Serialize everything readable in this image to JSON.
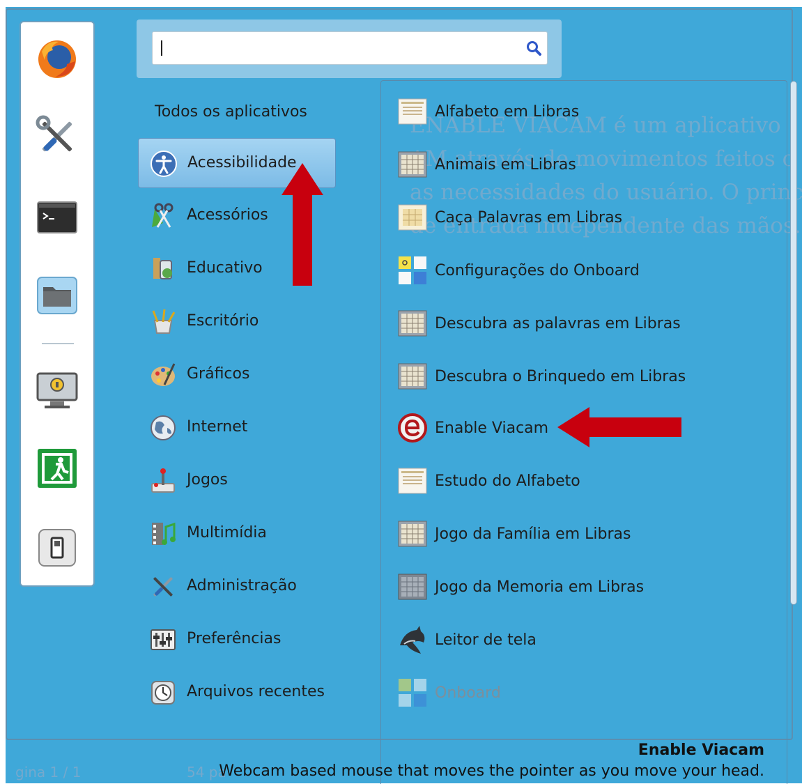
{
  "search": {
    "value": "",
    "placeholder": ""
  },
  "favorites": [
    "firefox-icon",
    "tools-icon",
    "terminal-icon",
    "folder-icon",
    "lock-screen-icon",
    "logout-icon",
    "shutdown-icon"
  ],
  "categories": {
    "header": "Todos os aplicativos",
    "items": [
      {
        "label": "Acessibilidade",
        "icon": "accessibility-icon",
        "selected": true
      },
      {
        "label": "Acessórios",
        "icon": "accessories-icon"
      },
      {
        "label": "Educativo",
        "icon": "education-icon"
      },
      {
        "label": "Escritório",
        "icon": "office-icon"
      },
      {
        "label": "Gráficos",
        "icon": "graphics-icon"
      },
      {
        "label": "Internet",
        "icon": "internet-icon"
      },
      {
        "label": "Jogos",
        "icon": "games-icon"
      },
      {
        "label": "Multimídia",
        "icon": "multimedia-icon"
      },
      {
        "label": "Administração",
        "icon": "administration-icon"
      },
      {
        "label": "Preferências",
        "icon": "preferences-icon"
      },
      {
        "label": "Arquivos recentes",
        "icon": "recent-files-icon"
      }
    ]
  },
  "apps": [
    {
      "label": "Alfabeto em Libras",
      "icon": "libras-doc-icon"
    },
    {
      "label": "Animais em Libras",
      "icon": "libras-grid-icon"
    },
    {
      "label": "Caça Palavras em Libras",
      "icon": "libras-doc-icon"
    },
    {
      "label": "Configurações do Onboard",
      "icon": "onboard-icon"
    },
    {
      "label": "Descubra as palavras em Libras",
      "icon": "libras-grid-icon"
    },
    {
      "label": "Descubra o Brinquedo em Libras",
      "icon": "libras-grid-icon"
    },
    {
      "label": "Enable Viacam",
      "icon": "viacam-icon"
    },
    {
      "label": "Estudo do Alfabeto",
      "icon": "libras-doc-icon"
    },
    {
      "label": "Jogo da Família em Libras",
      "icon": "libras-grid-icon"
    },
    {
      "label": "Jogo da Memoria em Libras",
      "icon": "libras-grid-icon"
    },
    {
      "label": "Leitor de tela",
      "icon": "screen-reader-icon"
    },
    {
      "label": "Onboard",
      "icon": "onboard-icon",
      "dim": true
    }
  ],
  "background_text": [
    "ENABLE VIACAM é um aplicativo",
    "AM através de movimentos feitos c",
    "as necessidades do usuário. O princ",
    "de entrada independente das mãos."
  ],
  "footer": {
    "title": "Enable Viacam",
    "description": "Webcam based mouse that moves the pointer as you move your head.",
    "page_ghost": "gina 1 / 1",
    "page_ghost2": "54 pa"
  },
  "colors": {
    "menu_bg": "#3fa8d9",
    "arrow": "#c8000e",
    "selection": "#8cc6ee"
  }
}
